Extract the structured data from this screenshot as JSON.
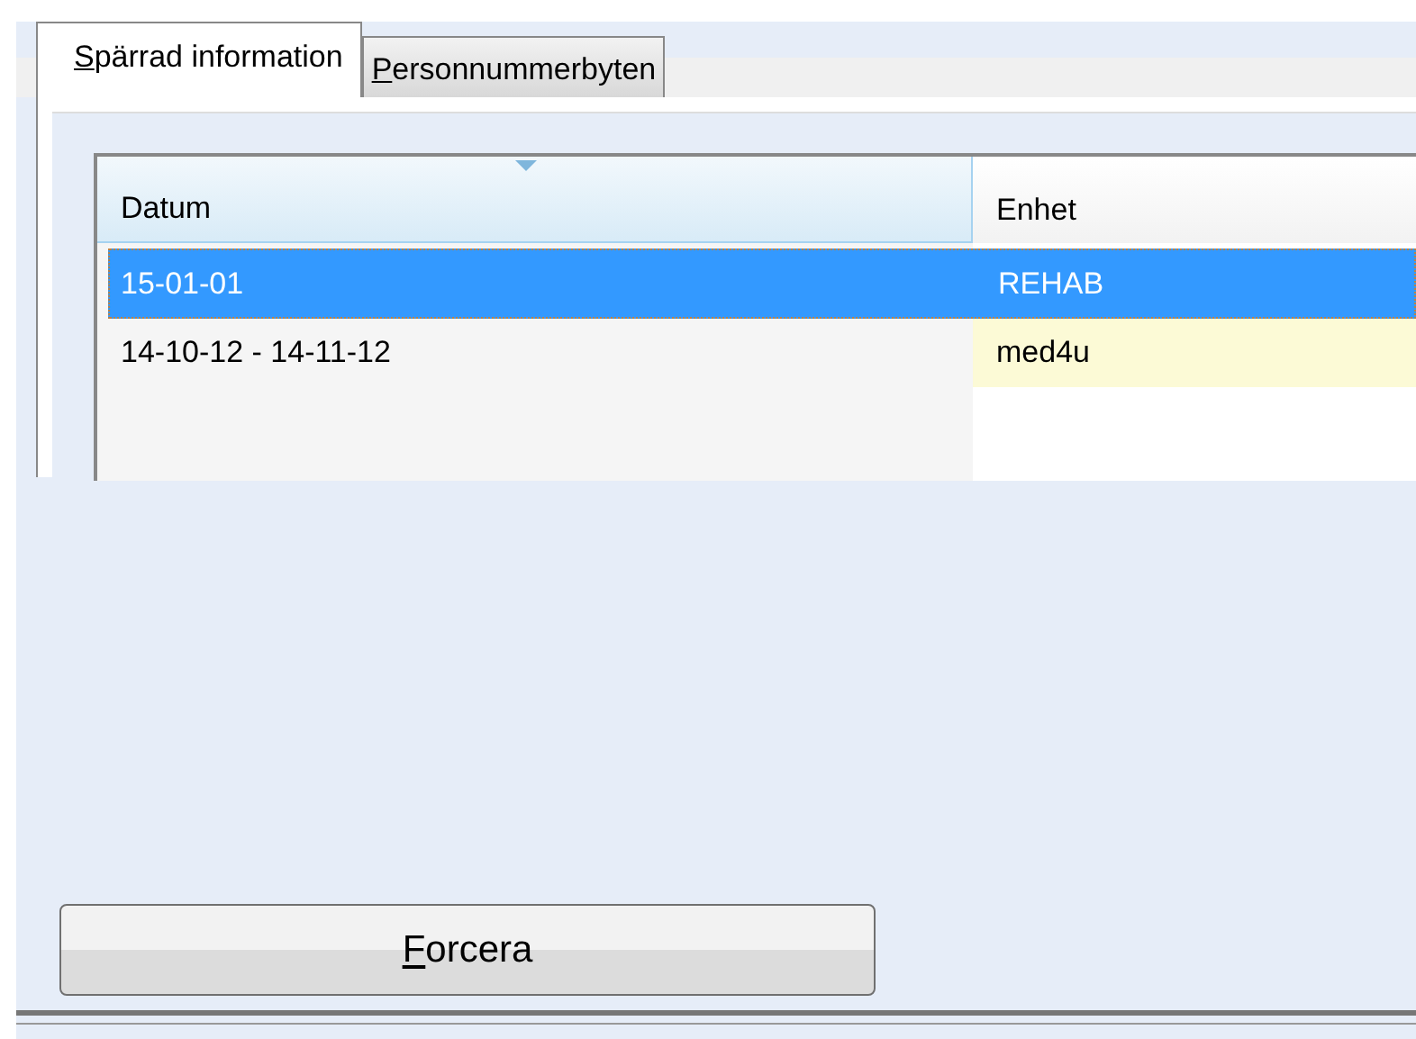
{
  "tabs": [
    {
      "label": "Spärrad information",
      "selected": true
    },
    {
      "label": "Personnummerbyten",
      "selected": false
    }
  ],
  "table": {
    "columns": [
      "Datum",
      "Enhet"
    ],
    "rows": [
      {
        "cells": [
          "15-01-01",
          "REHAB"
        ],
        "selected": true,
        "highlight": false
      },
      {
        "cells": [
          "14-10-12 - 14-11-12",
          "med4u"
        ],
        "selected": false,
        "highlight": true
      }
    ]
  },
  "buttons": [
    "Forcera"
  ]
}
